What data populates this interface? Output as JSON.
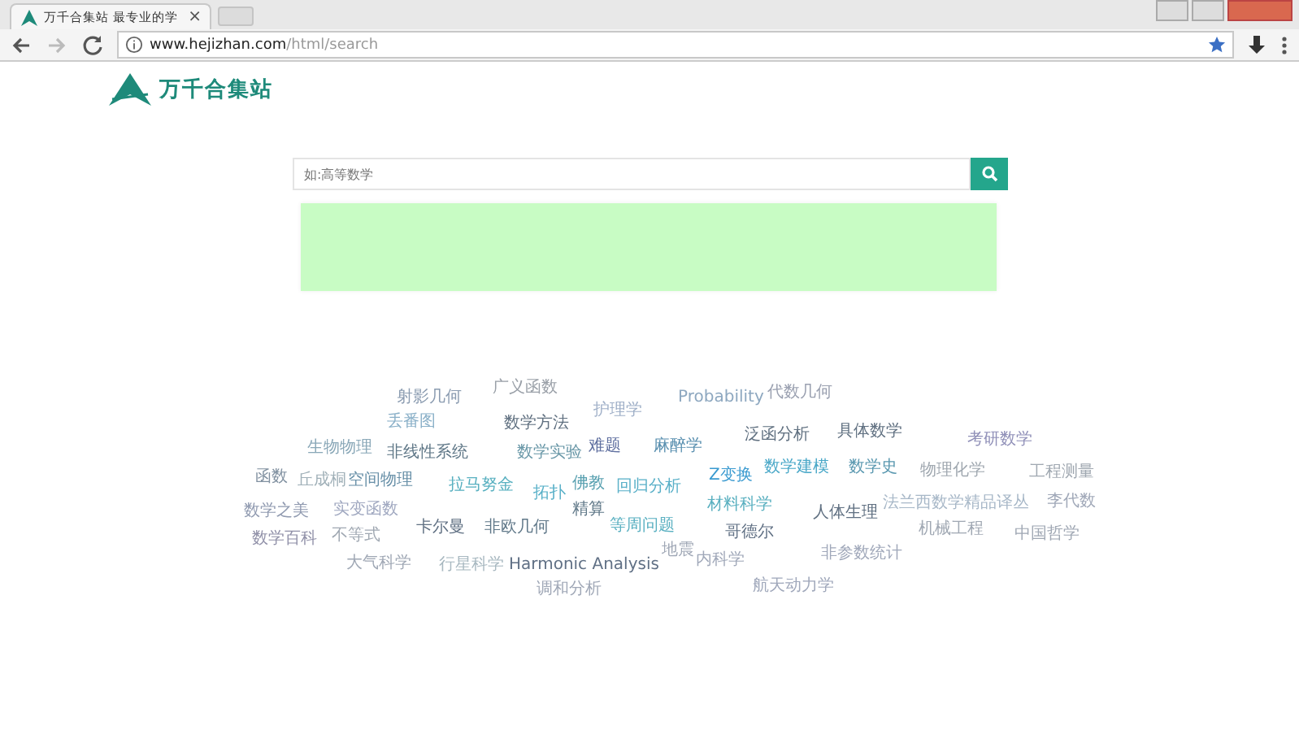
{
  "browser": {
    "tab_title": "万千合集站 最专业的学",
    "tab_close": "×",
    "url_host": "www.hejizhan.com",
    "url_path": "/html/search"
  },
  "logo": {
    "text": "万千合集站"
  },
  "search": {
    "placeholder": "如:高等数学"
  },
  "tags": [
    {
      "text": "射影几何",
      "color": "#8a9bb0"
    },
    {
      "text": "广义函数",
      "color": "#9aa0a8"
    },
    {
      "text": "Probability",
      "color": "#8ea8c0"
    },
    {
      "text": "代数几何",
      "color": "#9aa0b0"
    },
    {
      "text": "丢番图",
      "color": "#8ab0c8"
    },
    {
      "text": "数学方法",
      "color": "#607080"
    },
    {
      "text": "护理学",
      "color": "#a0b0c8"
    },
    {
      "text": "生物物理",
      "color": "#8aa8b8"
    },
    {
      "text": "非线性系统",
      "color": "#607888"
    },
    {
      "text": "数学实验",
      "color": "#6a98a8"
    },
    {
      "text": "难题",
      "color": "#6070a0"
    },
    {
      "text": "麻醉学",
      "color": "#5a90b0"
    },
    {
      "text": "泛函分析",
      "color": "#607080"
    },
    {
      "text": "具体数学",
      "color": "#607081"
    },
    {
      "text": "考研数学",
      "color": "#9090b8"
    },
    {
      "text": "函数",
      "color": "#8090a0"
    },
    {
      "text": "丘成桐",
      "color": "#a0b0b8"
    },
    {
      "text": "空间物理",
      "color": "#6890a8"
    },
    {
      "text": "拉马努金",
      "color": "#58b0c0"
    },
    {
      "text": "拓扑",
      "color": "#58b0c8"
    },
    {
      "text": "佛教",
      "color": "#58a0b0"
    },
    {
      "text": "回归分析",
      "color": "#5ab0c8"
    },
    {
      "text": "Z变换",
      "color": "#3a9ad0"
    },
    {
      "text": "数学建模",
      "color": "#4aa8c8"
    },
    {
      "text": "数学史",
      "color": "#5a98b0"
    },
    {
      "text": "物理化学",
      "color": "#a0a8b0"
    },
    {
      "text": "工程测量",
      "color": "#a0a8b1"
    },
    {
      "text": "数学之美",
      "color": "#909ab0"
    },
    {
      "text": "实变函数",
      "color": "#a0a8c0"
    },
    {
      "text": "精算",
      "color": "#607888"
    },
    {
      "text": "材料科学",
      "color": "#5ab0c0"
    },
    {
      "text": "人体生理",
      "color": "#607082"
    },
    {
      "text": "法兰西数学精品译丛",
      "color": "#a8b8c8"
    },
    {
      "text": "李代数",
      "color": "#a0a8b8"
    },
    {
      "text": "数学百科",
      "color": "#9090a8"
    },
    {
      "text": "不等式",
      "color": "#a0a8b2"
    },
    {
      "text": "卡尔曼",
      "color": "#607083"
    },
    {
      "text": "非欧几何",
      "color": "#607889"
    },
    {
      "text": "等周问题",
      "color": "#5ab0c1"
    },
    {
      "text": "哥德尔",
      "color": "#607084"
    },
    {
      "text": "机械工程",
      "color": "#a0a8b3"
    },
    {
      "text": "中国哲学",
      "color": "#a0a8b4"
    },
    {
      "text": "大气科学",
      "color": "#a0a8b5"
    },
    {
      "text": "行星科学",
      "color": "#a8b8c0"
    },
    {
      "text": "Harmonic Analysis",
      "color": "#607085"
    },
    {
      "text": "地震",
      "color": "#a0a8b6"
    },
    {
      "text": "内科学",
      "color": "#a0a8b9"
    },
    {
      "text": "非参数统计",
      "color": "#a0a8ba"
    },
    {
      "text": "调和分析",
      "color": "#a0a8b7"
    },
    {
      "text": "航天动力学",
      "color": "#a0a8bb"
    }
  ]
}
